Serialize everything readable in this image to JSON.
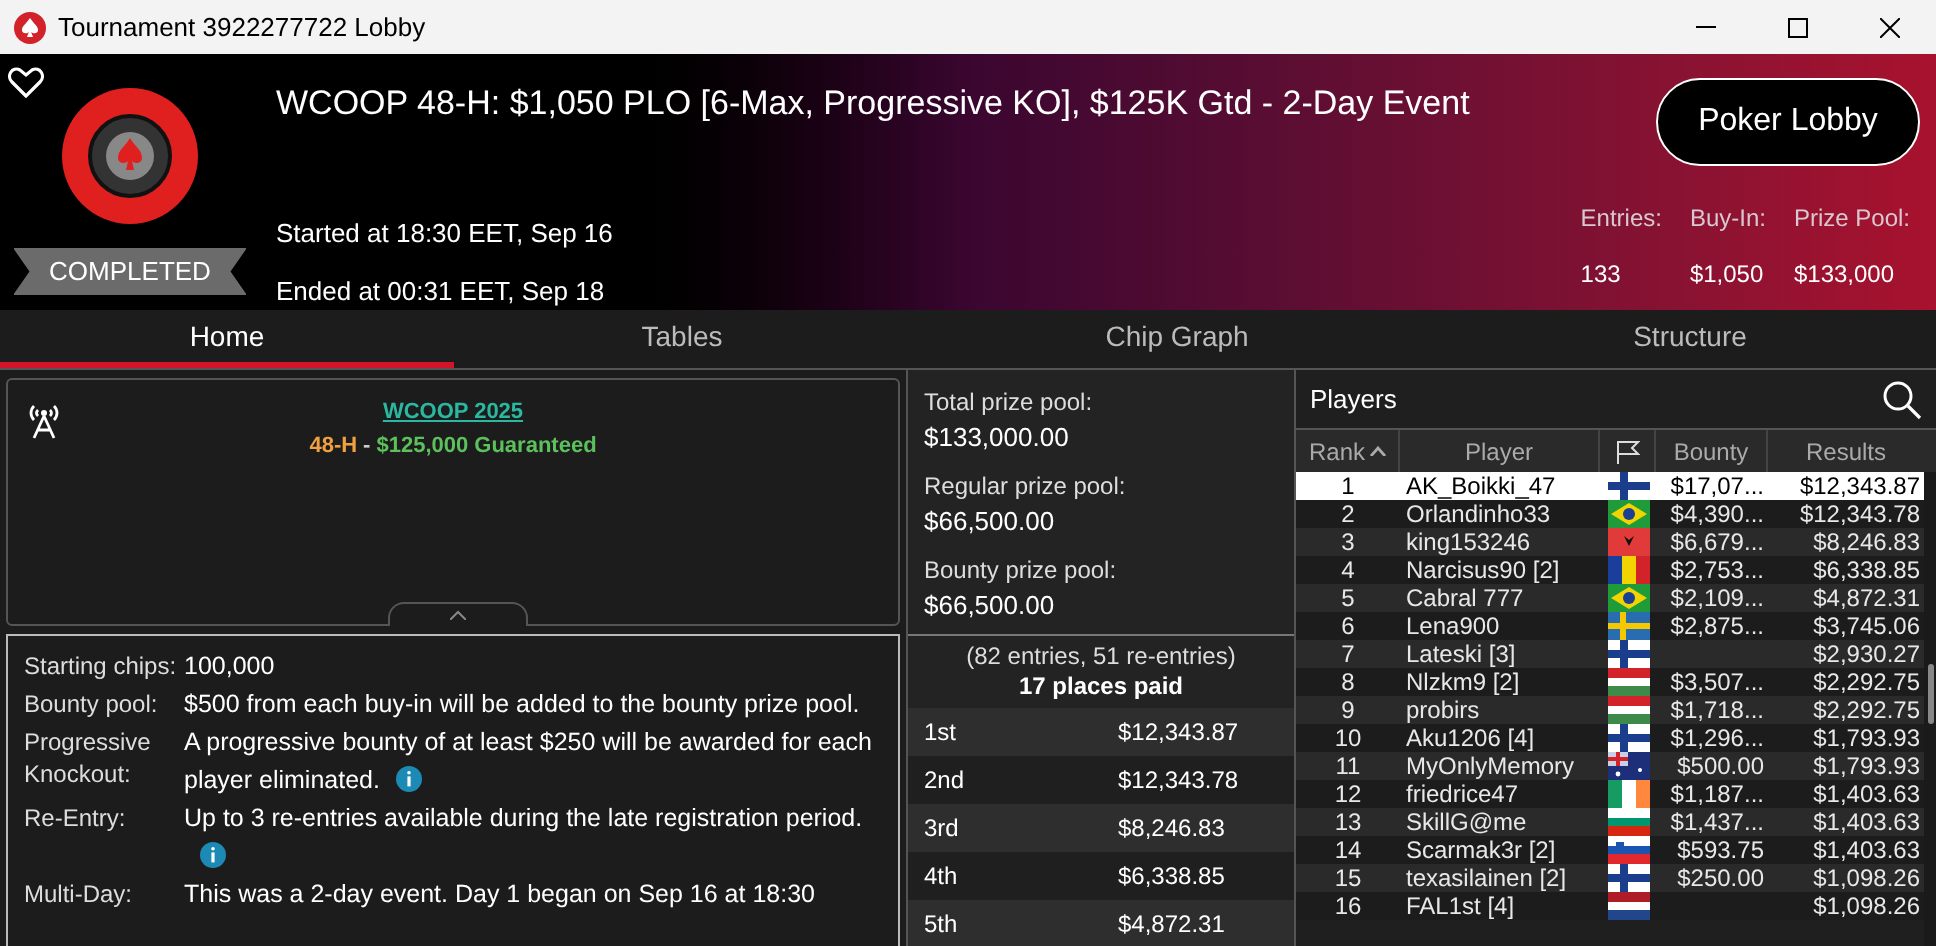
{
  "window": {
    "title": "Tournament 3922277722 Lobby"
  },
  "header": {
    "title": "WCOOP 48-H: $1,050 PLO [6-Max, Progressive KO], $125K Gtd - 2-Day Event",
    "status": "COMPLETED",
    "started": "Started at 18:30 EET, Sep 16",
    "ended": "Ended at 00:31 EET, Sep 18",
    "button": "Poker Lobby",
    "stats": [
      {
        "label": "Entries:",
        "value": "133"
      },
      {
        "label": "Buy-In:",
        "value": "$1,050"
      },
      {
        "label": "Prize Pool:",
        "value": "$133,000"
      }
    ]
  },
  "tabs": [
    {
      "label": "Home",
      "selected": true
    },
    {
      "label": "Tables",
      "selected": false
    },
    {
      "label": "Chip Graph",
      "selected": false
    },
    {
      "label": "Structure",
      "selected": false
    }
  ],
  "info_box": {
    "link": "WCOOP 2025",
    "event_code": "48-H",
    "separator": "-",
    "guarantee": "$125,000 Guaranteed"
  },
  "details": [
    {
      "label": "Starting chips:",
      "value": "100,000",
      "info": false
    },
    {
      "label": "Bounty pool:",
      "value": "$500 from each buy-in will be added to the bounty prize pool.",
      "info": false
    },
    {
      "label": "Progressive Knockout:",
      "value": "A progressive bounty of at least $250 will be awarded for each player eliminated.",
      "info": true
    },
    {
      "label": "Re-Entry:",
      "value": "Up to 3 re-entries available during the late registration period.",
      "info": true
    },
    {
      "label": "Multi-Day:",
      "value": "This was a 2-day event. Day 1 began on Sep 16 at 18:30",
      "info": false
    }
  ],
  "prize_pools": [
    {
      "label": "Total prize pool:",
      "value": "$133,000.00"
    },
    {
      "label": "Regular prize pool:",
      "value": "$66,500.00"
    },
    {
      "label": "Bounty prize pool:",
      "value": "$66,500.00"
    }
  ],
  "payout": {
    "entries_note": "(82 entries, 51 re-entries)",
    "places_paid": "17 places paid",
    "rows": [
      {
        "place": "1st",
        "amount": "$12,343.87"
      },
      {
        "place": "2nd",
        "amount": "$12,343.78"
      },
      {
        "place": "3rd",
        "amount": "$8,246.83"
      },
      {
        "place": "4th",
        "amount": "$6,338.85"
      },
      {
        "place": "5th",
        "amount": "$4,872.31"
      }
    ]
  },
  "players": {
    "title": "Players",
    "columns": [
      "Rank",
      "Player",
      "Bounty",
      "Results"
    ],
    "rows": [
      {
        "rank": "1",
        "player": "AK_Boikki_47",
        "kind": "fi",
        "bounty": "$17,07...",
        "results": "$12,343.87",
        "selected": true
      },
      {
        "rank": "2",
        "player": "Orlandinho33",
        "kind": "br",
        "bounty": "$4,390...",
        "results": "$12,343.78",
        "selected": false
      },
      {
        "rank": "3",
        "player": "king153246",
        "kind": "al",
        "bounty": "$6,679...",
        "results": "$8,246.83",
        "selected": false
      },
      {
        "rank": "4",
        "player": "Narcisus90 [2]",
        "kind": "ro",
        "bounty": "$2,753...",
        "results": "$6,338.85",
        "selected": false
      },
      {
        "rank": "5",
        "player": "Cabral 777",
        "kind": "br",
        "bounty": "$2,109...",
        "results": "$4,872.31",
        "selected": false
      },
      {
        "rank": "6",
        "player": "Lena900",
        "kind": "se",
        "bounty": "$2,875...",
        "results": "$3,745.06",
        "selected": false
      },
      {
        "rank": "7",
        "player": "Lateski [3]",
        "kind": "fi",
        "results": "$2,930.27",
        "selected": false
      },
      {
        "rank": "8",
        "player": "Nlzkm9 [2]",
        "kind": "hu",
        "bounty": "$3,507...",
        "results": "$2,292.75",
        "selected": false
      },
      {
        "rank": "9",
        "player": "probirs",
        "kind": "hu",
        "bounty": "$1,718...",
        "results": "$2,292.75",
        "selected": false
      },
      {
        "rank": "10",
        "player": "Aku1206 [4]",
        "kind": "fi",
        "bounty": "$1,296...",
        "results": "$1,793.93",
        "selected": false
      },
      {
        "rank": "11",
        "player": "MyOnlyMemory",
        "kind": "au",
        "bounty": "$500.00",
        "results": "$1,793.93",
        "selected": false
      },
      {
        "rank": "12",
        "player": "friedrice47",
        "kind": "ie",
        "bounty": "$1,187...",
        "results": "$1,403.63",
        "selected": false
      },
      {
        "rank": "13",
        "player": "SkillG@me",
        "kind": "bg",
        "bounty": "$1,437...",
        "results": "$1,403.63",
        "selected": false
      },
      {
        "rank": "14",
        "player": "Scarmak3r [2]",
        "kind": "si",
        "bounty": "$593.75",
        "results": "$1,403.63",
        "selected": false
      },
      {
        "rank": "15",
        "player": "texasilainen [2]",
        "kind": "fi",
        "bounty": "$250.00",
        "results": "$1,098.26",
        "selected": false
      },
      {
        "rank": "16",
        "player": "FAL1st [4]",
        "kind": "nl",
        "results": "$1,098.26",
        "selected": false
      }
    ]
  }
}
